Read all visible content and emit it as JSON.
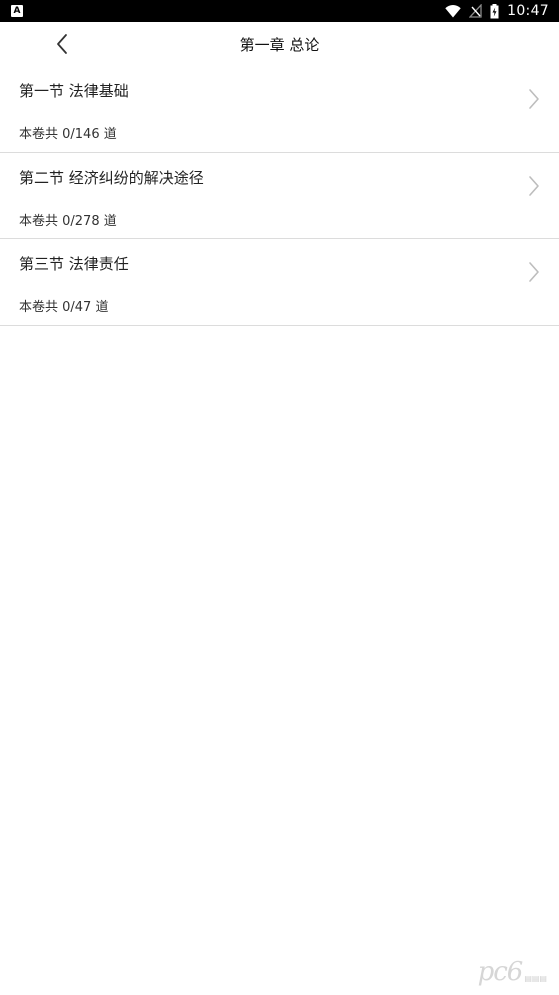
{
  "status_bar": {
    "left_icon_label": "A",
    "time": "10:47",
    "icons": [
      "wifi-icon",
      "no-signal-icon",
      "battery-charging-icon"
    ]
  },
  "header": {
    "title": "第一章 总论",
    "back_icon": "chevron-left-icon"
  },
  "sections": [
    {
      "title": "第一节 法律基础",
      "count": "本卷共 0/146 道"
    },
    {
      "title": "第二节 经济纠纷的解决途径",
      "count": "本卷共 0/278 道"
    },
    {
      "title": "第三节 法律责任",
      "count": "本卷共 0/47 道"
    }
  ],
  "watermark": {
    "logo": "pc6"
  },
  "colors": {
    "status_bar_bg": "#000000",
    "background": "#ffffff",
    "divider": "#dcdcdc",
    "chevron": "#bdbdbd"
  }
}
